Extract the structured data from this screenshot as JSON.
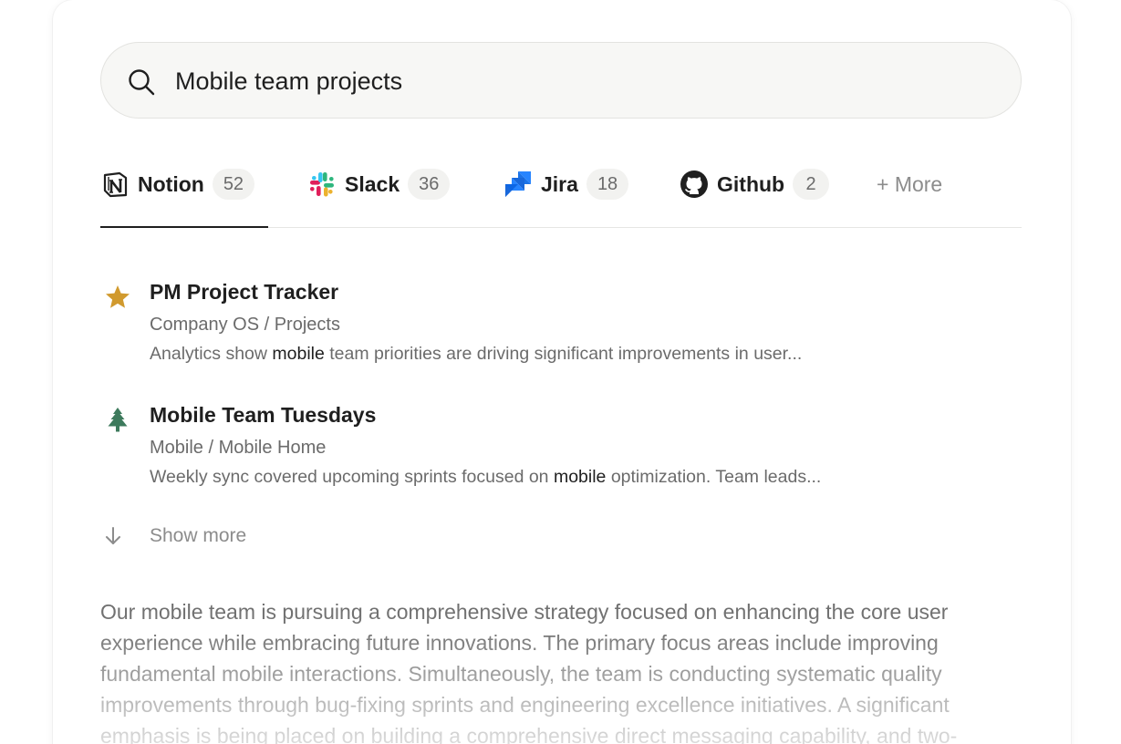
{
  "search": {
    "value": "Mobile team projects",
    "icon": "search-icon"
  },
  "tabs": [
    {
      "label": "Notion",
      "count": "52",
      "icon": "notion-icon",
      "active": true
    },
    {
      "label": "Slack",
      "count": "36",
      "icon": "slack-icon",
      "active": false
    },
    {
      "label": "Jira",
      "count": "18",
      "icon": "jira-icon",
      "active": false
    },
    {
      "label": "Github",
      "count": "2",
      "icon": "github-icon",
      "active": false
    }
  ],
  "more_tab": {
    "label": "+ More"
  },
  "results": [
    {
      "icon": "star-icon",
      "icon_color": "#d19a2e",
      "title": "PM Project Tracker",
      "path": "Company OS / Projects",
      "snippet_before": "Analytics show ",
      "snippet_highlight": "mobile",
      "snippet_after": " team priorities are driving significant improvements in user..."
    },
    {
      "icon": "tree-icon",
      "icon_color": "#3d7a5c",
      "title": "Mobile Team Tuesdays",
      "path": "Mobile / Mobile Home",
      "snippet_before": "Weekly sync covered upcoming sprints focused on ",
      "snippet_highlight": "mobile",
      "snippet_after": " optimization. Team leads..."
    }
  ],
  "show_more": {
    "label": "Show more",
    "icon": "arrow-down-icon"
  },
  "answer": {
    "lines": [
      "Our mobile team is pursuing a comprehensive strategy focused on enhancing the core user",
      "experience while embracing future innovations. The primary focus areas include improving",
      "fundamental mobile interactions. Simultaneously, the team is conducting systematic quality",
      "improvements through bug-fixing sprints and engineering excellence initiatives. A significant",
      "emphasis is being placed on building a comprehensive direct messaging capability, and two-"
    ]
  },
  "colors": {
    "text_primary": "#1f1f1f",
    "text_secondary": "#6b6b6b",
    "text_muted": "#8c8c8c",
    "search_bg": "#f7f7f5",
    "badge_bg": "#f2f2f0"
  }
}
